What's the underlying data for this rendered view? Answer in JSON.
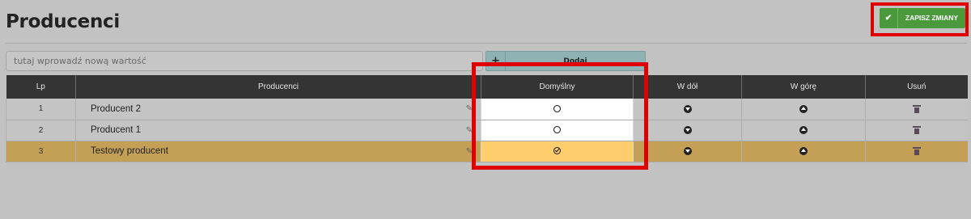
{
  "page": {
    "title": "Producenci"
  },
  "toolbar": {
    "save_label": "ZAPISZ ZMIANY",
    "save_icon": "check-icon"
  },
  "new_value": {
    "placeholder": "tutaj wprowadź nową wartość",
    "add_label": "Dodaj",
    "add_symbol": "+"
  },
  "table": {
    "columns": [
      "Lp",
      "Producenci",
      "Domyślny",
      "W dół",
      "W górę",
      "Usuń"
    ],
    "rows": [
      {
        "lp": "1",
        "name": "Producent 2",
        "default": false
      },
      {
        "lp": "2",
        "name": "Producent 1",
        "default": false
      },
      {
        "lp": "3",
        "name": "Testowy producent",
        "default": true
      }
    ]
  },
  "colors": {
    "save_button": "#4a9a3c",
    "highlight": "#e00000",
    "active_row": "#c49f56",
    "active_default_cell": "#fece6c"
  }
}
